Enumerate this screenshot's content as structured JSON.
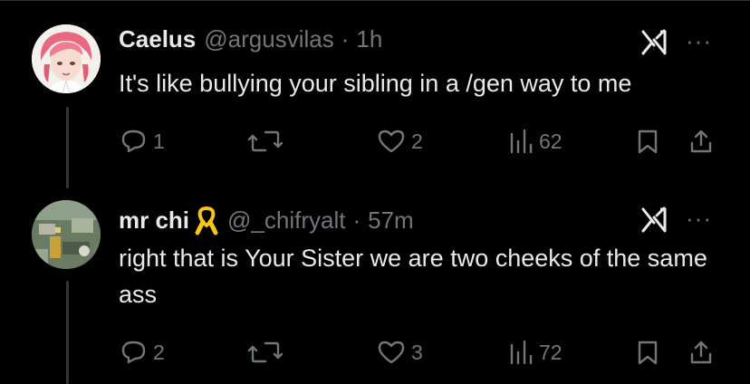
{
  "tweets": [
    {
      "name": "Caelus",
      "handle": "@argusvilas",
      "sep": "·",
      "time": "1h",
      "text": "It's like bullying your sibling in a /gen way to me",
      "replies": "1",
      "retweets": "",
      "likes": "2",
      "views": "62",
      "more": "···"
    },
    {
      "name": "mr chi",
      "badge_icon": "yellow-ribbon-icon",
      "handle": "@_chifryalt",
      "sep": "·",
      "time": "57m",
      "text": "right that is Your Sister we are two cheeks of the same ass",
      "replies": "2",
      "retweets": "",
      "likes": "3",
      "views": "72",
      "more": "···"
    }
  ],
  "colors": {
    "background": "#000000",
    "text": "#e7e9ea",
    "muted": "#71767b",
    "thread_line": "#333639",
    "ribbon": "#f5c518"
  }
}
